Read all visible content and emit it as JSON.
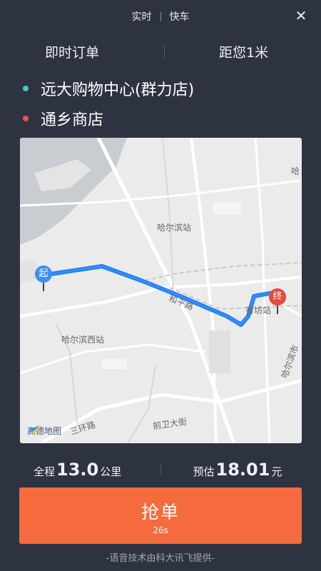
{
  "header": {
    "tab_realtime": "实时",
    "tab_express": "快车",
    "close_icon": "close-icon"
  },
  "order": {
    "type_label": "即时订单",
    "distance_label": "距您1米"
  },
  "route": {
    "start_address": "远大购物中心(群力店)",
    "end_address": "通乡商店",
    "start_color": "#3ecdb5",
    "end_color": "#e5573f"
  },
  "map": {
    "labels": {
      "harbin_station": "哈尔滨站",
      "harbin_west_station": "哈尔滨西站",
      "xiangfang_station": "香坊站",
      "road_heping": "和平路",
      "road_third_ring": "三环路",
      "road_qianwei": "前卫大街",
      "road_gongnong": "哈尔滨市",
      "corner_ha": "哈"
    },
    "start_marker": "起",
    "end_marker": "终",
    "logo_text": "高德地图",
    "route_color": "#1f7ef5"
  },
  "stats": {
    "distance_prefix": "全程",
    "distance_value": "13.0",
    "distance_unit": "公里",
    "price_prefix": "预估",
    "price_value": "18.01",
    "price_unit": "元"
  },
  "action": {
    "grab_label": "抢单",
    "countdown": "26s",
    "accent": "#f56b3d"
  },
  "footer": {
    "credit": "-语音技术由科大讯飞提供-"
  }
}
